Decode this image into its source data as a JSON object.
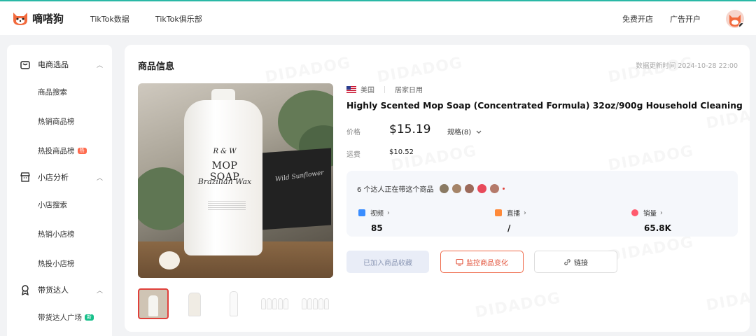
{
  "app": {
    "logo_text": "嘀嗒狗"
  },
  "topnav": {
    "item1": "TikTok数据",
    "item2": "TikTok俱乐部",
    "right1": "免费开店",
    "right2": "广告开户"
  },
  "sidebar": {
    "groups": [
      {
        "label": "电商选品",
        "items": [
          {
            "label": "商品搜索"
          },
          {
            "label": "热销商品榜"
          },
          {
            "label": "热投商品榜",
            "tag": "热"
          }
        ]
      },
      {
        "label": "小店分析",
        "items": [
          {
            "label": "小店搜索"
          },
          {
            "label": "热销小店榜"
          },
          {
            "label": "热投小店榜"
          }
        ]
      },
      {
        "label": "带货达人",
        "items": [
          {
            "label": "带货达人广场",
            "tag": "新"
          }
        ]
      }
    ]
  },
  "main": {
    "section_title": "商品信息",
    "updated": "数据更新时间 2024-10-28 22:00",
    "watermark": "DIDADOG",
    "image_text": {
      "line0": "R & W",
      "line1": "MOP SOAP",
      "line2": "Brazilian Wax",
      "box": "Wild Sunflower"
    },
    "country": "美国",
    "category": "居家日用",
    "title": "Highly Scented Mop Soap (Concentrated Formula) 32oz/900g Household Cleaning",
    "price_label": "价格",
    "price": "$15.19",
    "spec": "规格(8)",
    "ship_label": "运费",
    "ship": "$10.52",
    "stats_head": "6 个达人正在带这个商品",
    "stats": [
      {
        "label": "视频",
        "value": "85"
      },
      {
        "label": "直播",
        "value": "/"
      },
      {
        "label": "销量",
        "value": "65.8K"
      }
    ],
    "buttons": {
      "fav": "已加入商品收藏",
      "monitor": "监控商品变化",
      "link": "链接"
    }
  },
  "colors": {
    "accent": "#ef6a4a",
    "brand_teal": "#2ab8a6"
  }
}
